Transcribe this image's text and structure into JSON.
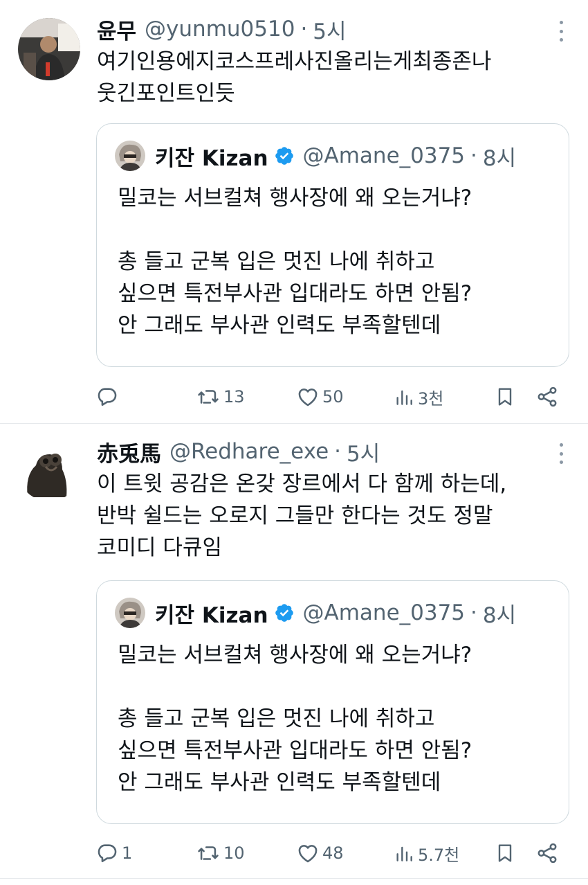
{
  "tweets": [
    {
      "author": {
        "name": "윤무",
        "handle": "@yunmu0510",
        "time": "5시"
      },
      "text": "여기인용에지코스프레사진올리는게최종존나\n웃긴포인트인듯",
      "quote": {
        "author": {
          "name": "키잔 Kizan",
          "handle": "@Amane_0375",
          "time": "8시"
        },
        "text": "밀코는 서브컬쳐 행사장에 왜 오는거냐?\n\n총 들고 군복 입은 멋진 나에 취하고\n싶으면 특전부사관 입대라도 하면 안됨?\n안 그래도 부사관 인력도 부족할텐데"
      },
      "actions": {
        "replies": "",
        "retweets": "13",
        "likes": "50",
        "views": "3천"
      }
    },
    {
      "author": {
        "name": "赤兎馬",
        "handle": "@Redhare_exe",
        "time": "5시"
      },
      "text": "이 트윗 공감은 온갖 장르에서 다 함께 하는데,\n반박 쉴드는 오로지 그들만 한다는 것도 정말\n코미디 다큐임",
      "quote": {
        "author": {
          "name": "키잔 Kizan",
          "handle": "@Amane_0375",
          "time": "8시"
        },
        "text": "밀코는 서브컬쳐 행사장에 왜 오는거냐?\n\n총 들고 군복 입은 멋진 나에 취하고\n싶으면 특전부사관 입대라도 하면 안됨?\n안 그래도 부사관 인력도 부족할텐데"
      },
      "actions": {
        "replies": "1",
        "retweets": "10",
        "likes": "48",
        "views": "5.7천"
      }
    }
  ],
  "separator": "·",
  "icons": {
    "reply": "reply-icon",
    "retweet": "retweet-icon",
    "like": "heart-icon",
    "views": "views-icon",
    "bookmark": "bookmark-icon",
    "share": "share-icon",
    "more": "more-icon",
    "verified": "verified-badge-icon"
  },
  "colors": {
    "text": "#0f1419",
    "secondary": "#536471",
    "border": "#cfd9de",
    "verified": "#1d9bf0",
    "divider": "#e6e9ec"
  }
}
